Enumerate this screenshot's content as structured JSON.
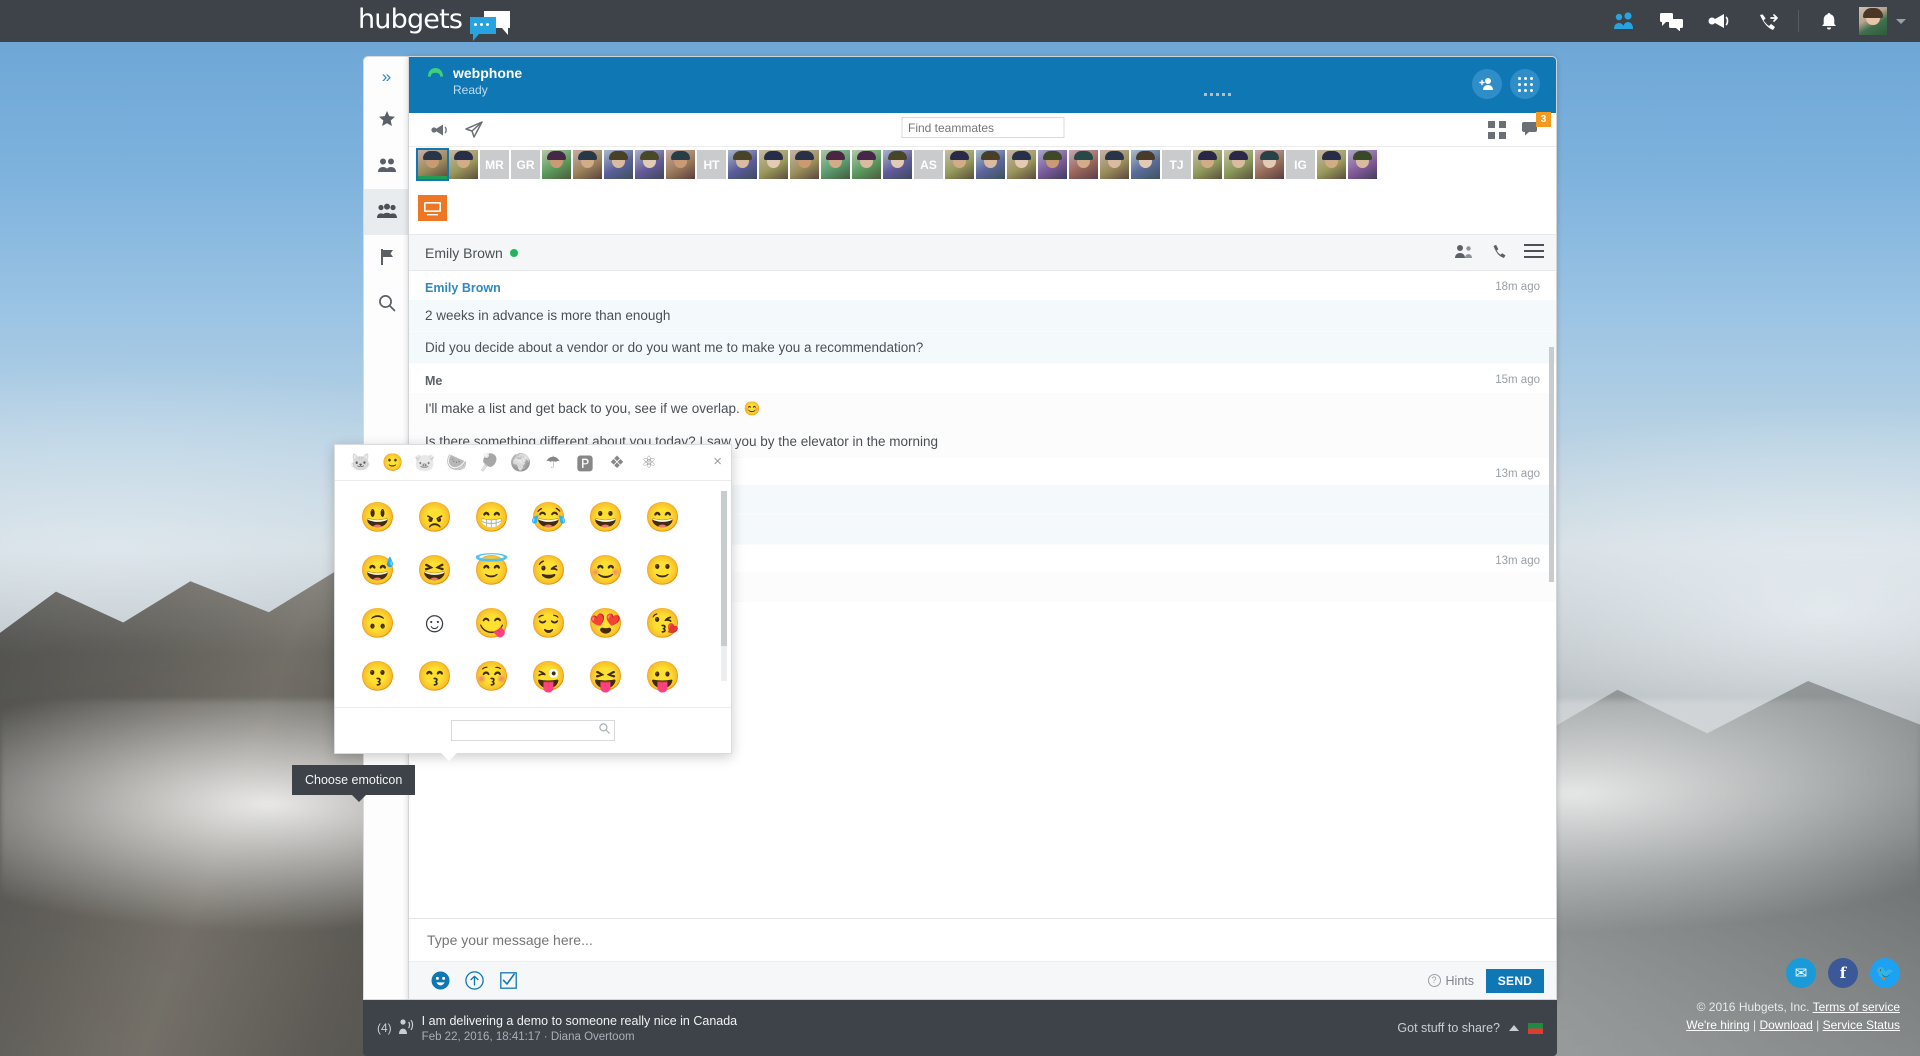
{
  "topbar": {
    "logo_text": "hubgets",
    "icons": [
      {
        "name": "contacts-icon",
        "glyph": "people"
      },
      {
        "name": "chat-icon",
        "glyph": "chat"
      },
      {
        "name": "megaphone-icon",
        "glyph": "megaphone"
      },
      {
        "name": "call-forward-icon",
        "glyph": "call"
      },
      {
        "name": "notifications-bell-icon",
        "glyph": "bell"
      }
    ]
  },
  "rail": {
    "items": [
      {
        "name": "expand-rail",
        "glyph": "»"
      },
      {
        "name": "favorites",
        "glyph": "star"
      },
      {
        "name": "contacts",
        "glyph": "people"
      },
      {
        "name": "teams",
        "glyph": "group"
      },
      {
        "name": "flags",
        "glyph": "flag"
      },
      {
        "name": "search",
        "glyph": "search"
      }
    ]
  },
  "webphone": {
    "title": "webphone",
    "status": "Ready",
    "add_person_label": "add-person",
    "dialpad_label": "dialpad"
  },
  "teammates_toolbar": {
    "search_placeholder": "Find teammates",
    "search_value": "",
    "chat_badge": "3"
  },
  "avatars": [
    {
      "initials": "",
      "hue": 14,
      "sel": true,
      "status": "#1f9d55"
    },
    {
      "initials": "",
      "hue": 28,
      "sel": false,
      "status": ""
    },
    {
      "initials": "MR",
      "hue": 0,
      "sel": false,
      "status": ""
    },
    {
      "initials": "GR",
      "hue": 0,
      "sel": false,
      "status": ""
    },
    {
      "initials": "",
      "hue": 92,
      "sel": false,
      "status": ""
    },
    {
      "initials": "",
      "hue": 8,
      "sel": false,
      "status": ""
    },
    {
      "initials": "",
      "hue": 205,
      "sel": false,
      "status": ""
    },
    {
      "initials": "",
      "hue": 220,
      "sel": false,
      "status": ""
    },
    {
      "initials": "",
      "hue": 0,
      "sel": false,
      "status": ""
    },
    {
      "initials": "HT",
      "hue": 0,
      "sel": false,
      "status": ""
    },
    {
      "initials": "",
      "hue": 210,
      "sel": false,
      "status": ""
    },
    {
      "initials": "",
      "hue": 30,
      "sel": false,
      "status": ""
    },
    {
      "initials": "",
      "hue": 20,
      "sel": false,
      "status": ""
    },
    {
      "initials": "",
      "hue": 110,
      "sel": false,
      "status": "busy"
    },
    {
      "initials": "",
      "hue": 95,
      "sel": false,
      "status": "busy"
    },
    {
      "initials": "",
      "hue": 215,
      "sel": false,
      "status": "busy"
    },
    {
      "initials": "AS",
      "hue": 0,
      "sel": false,
      "status": ""
    },
    {
      "initials": "",
      "hue": 35,
      "sel": false,
      "status": ""
    },
    {
      "initials": "",
      "hue": 200,
      "sel": false,
      "status": ""
    },
    {
      "initials": "",
      "hue": 25,
      "sel": false,
      "status": ""
    },
    {
      "initials": "",
      "hue": 240,
      "sel": false,
      "status": ""
    },
    {
      "initials": "",
      "hue": 340,
      "sel": false,
      "status": ""
    },
    {
      "initials": "",
      "hue": 18,
      "sel": false,
      "status": ""
    },
    {
      "initials": "",
      "hue": 195,
      "sel": false,
      "status": ""
    },
    {
      "initials": "TJ",
      "hue": 0,
      "sel": false,
      "status": ""
    },
    {
      "initials": "",
      "hue": 40,
      "sel": false,
      "status": ""
    },
    {
      "initials": "",
      "hue": 45,
      "sel": false,
      "status": ""
    },
    {
      "initials": "",
      "hue": 350,
      "sel": false,
      "status": ""
    },
    {
      "initials": "IG",
      "hue": 0,
      "sel": false,
      "status": ""
    },
    {
      "initials": "",
      "hue": 30,
      "sel": false,
      "status": ""
    },
    {
      "initials": "",
      "hue": 250,
      "sel": false,
      "status": ""
    }
  ],
  "conversation": {
    "contact_name": "Emily Brown",
    "presence": "online",
    "groups": [
      {
        "author": "Emily Brown",
        "is_me": false,
        "time": "18m ago",
        "messages": [
          "2 weeks in advance is more than enough",
          "Did you decide about a vendor or do you want me to make you a recommendation?"
        ]
      },
      {
        "author": "Me",
        "is_me": true,
        "time": "15m ago",
        "messages": [
          "I'll make a list and get back to you, see if we overlap.   😊",
          "Is there something different about you today? I saw you by the elevator in the morning"
        ]
      },
      {
        "author": "",
        "is_me": false,
        "time": "13m ago",
        "messages": [
          "",
          ""
        ]
      },
      {
        "author": "",
        "is_me": true,
        "time": "13m ago",
        "messages": [
          ""
        ]
      }
    ]
  },
  "composer": {
    "placeholder": "Type your message here...",
    "value": "",
    "hints_label": "Hints",
    "send_label": "SEND",
    "emoticon_tooltip": "Choose emoticon"
  },
  "emoji_picker": {
    "tabs": [
      {
        "name": "recent-emoji-tab",
        "glyph": "🐱",
        "active": false
      },
      {
        "name": "smileys-emoji-tab",
        "glyph": "🙂",
        "active": true
      },
      {
        "name": "animals-emoji-tab",
        "glyph": "🐷",
        "active": false
      },
      {
        "name": "food-emoji-tab",
        "glyph": "🍉",
        "active": false
      },
      {
        "name": "activity-emoji-tab",
        "glyph": "🏓",
        "active": false
      },
      {
        "name": "travel-emoji-tab",
        "glyph": "🌍",
        "active": false
      },
      {
        "name": "objects-emoji-tab",
        "glyph": "☂",
        "active": false
      },
      {
        "name": "symbols-emoji-tab",
        "glyph": "🅿",
        "active": false
      },
      {
        "name": "flags-emoji-tab",
        "glyph": "❖",
        "active": false
      },
      {
        "name": "settings-emoji-tab",
        "glyph": "⚛",
        "active": false
      }
    ],
    "close_label": "×",
    "search_placeholder": "",
    "search_value": "",
    "rows": [
      [
        "😃",
        "😠",
        "😁",
        "😂",
        "😀",
        "😄"
      ],
      [
        "😅",
        "😆",
        "😇",
        "😉",
        "😊",
        "🙂"
      ],
      [
        "🙃",
        "☺",
        "😋",
        "😌",
        "😍",
        "😘"
      ],
      [
        "😗",
        "😙",
        "😚",
        "😜",
        "😝",
        "😛"
      ]
    ]
  },
  "status_footer": {
    "count": "(4)",
    "line1": "I am delivering a demo to someone really nice in Canada",
    "line2": "Feb 22, 2016, 18:41:17  ·  Diana Overtoom",
    "got_stuff_label": "Got stuff to share?"
  },
  "page_footer": {
    "copyright": "© 2016 Hubgets, Inc. ",
    "terms": "Terms of service",
    "hiring": "We're hiring",
    "download": "Download",
    "service_status": "Service Status",
    "sep": " | "
  },
  "social": [
    {
      "name": "hubgets-social-link",
      "glyph": "✉",
      "cls": "hub"
    },
    {
      "name": "facebook-link",
      "glyph": "f",
      "cls": "fb"
    },
    {
      "name": "twitter-link",
      "glyph": "🐦",
      "cls": "tw"
    }
  ],
  "colors": {
    "accent": "#1077b5",
    "dark": "#3d4349",
    "badge": "#f39a21",
    "online": "#26b35e"
  }
}
